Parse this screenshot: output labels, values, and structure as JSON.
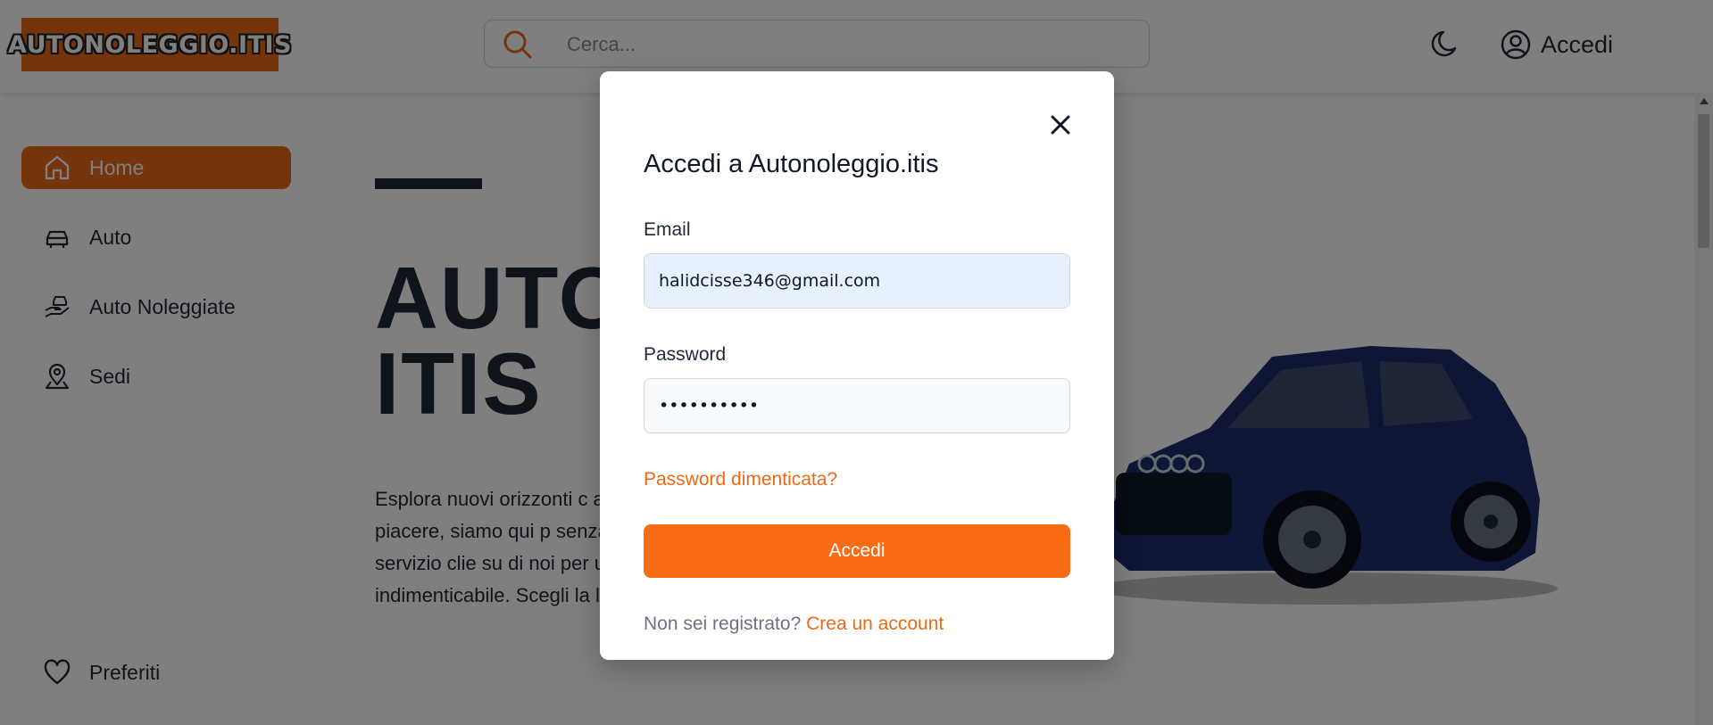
{
  "header": {
    "logo_text": "AUTONOLEGGIO.ITIS",
    "search_placeholder": "Cerca...",
    "login_label": "Accedi"
  },
  "sidebar": {
    "items": [
      {
        "label": "Home",
        "icon": "home-icon",
        "active": true
      },
      {
        "label": "Auto",
        "icon": "car-icon"
      },
      {
        "label": "Auto Noleggiate",
        "icon": "hand-car-icon"
      },
      {
        "label": "Sedi",
        "icon": "location-pin-icon"
      }
    ],
    "favorites_label": "Preferiti"
  },
  "hero": {
    "title_line1": "AUTO",
    "title_line2": "ITIS",
    "text": "Esplora nuovi orizzonti c autonoleggio. Sia che tu per piacere, siamo qui p senza stress. Con una v qualità e un servizio clie su di noi per un'esperienza di noleggio indimenticabile. Scegli la libertà. Scegli Autonoleggio ITIS."
  },
  "modal": {
    "title": "Accedi a Autonoleggio.itis",
    "email_label": "Email",
    "email_value": "halidcisse346@gmail.com",
    "password_label": "Password",
    "password_value": "••••••••••",
    "forgot_link": "Password dimenticata?",
    "submit_label": "Accedi",
    "register_text": "Non sei registrato?",
    "register_link": "Crea un account"
  },
  "colors": {
    "accent": "#ea6a18",
    "button": "#f76c15",
    "dark_text": "#1f2937",
    "overlay": "rgba(0,0,0,0.5)",
    "car": "#1c2a6b"
  }
}
